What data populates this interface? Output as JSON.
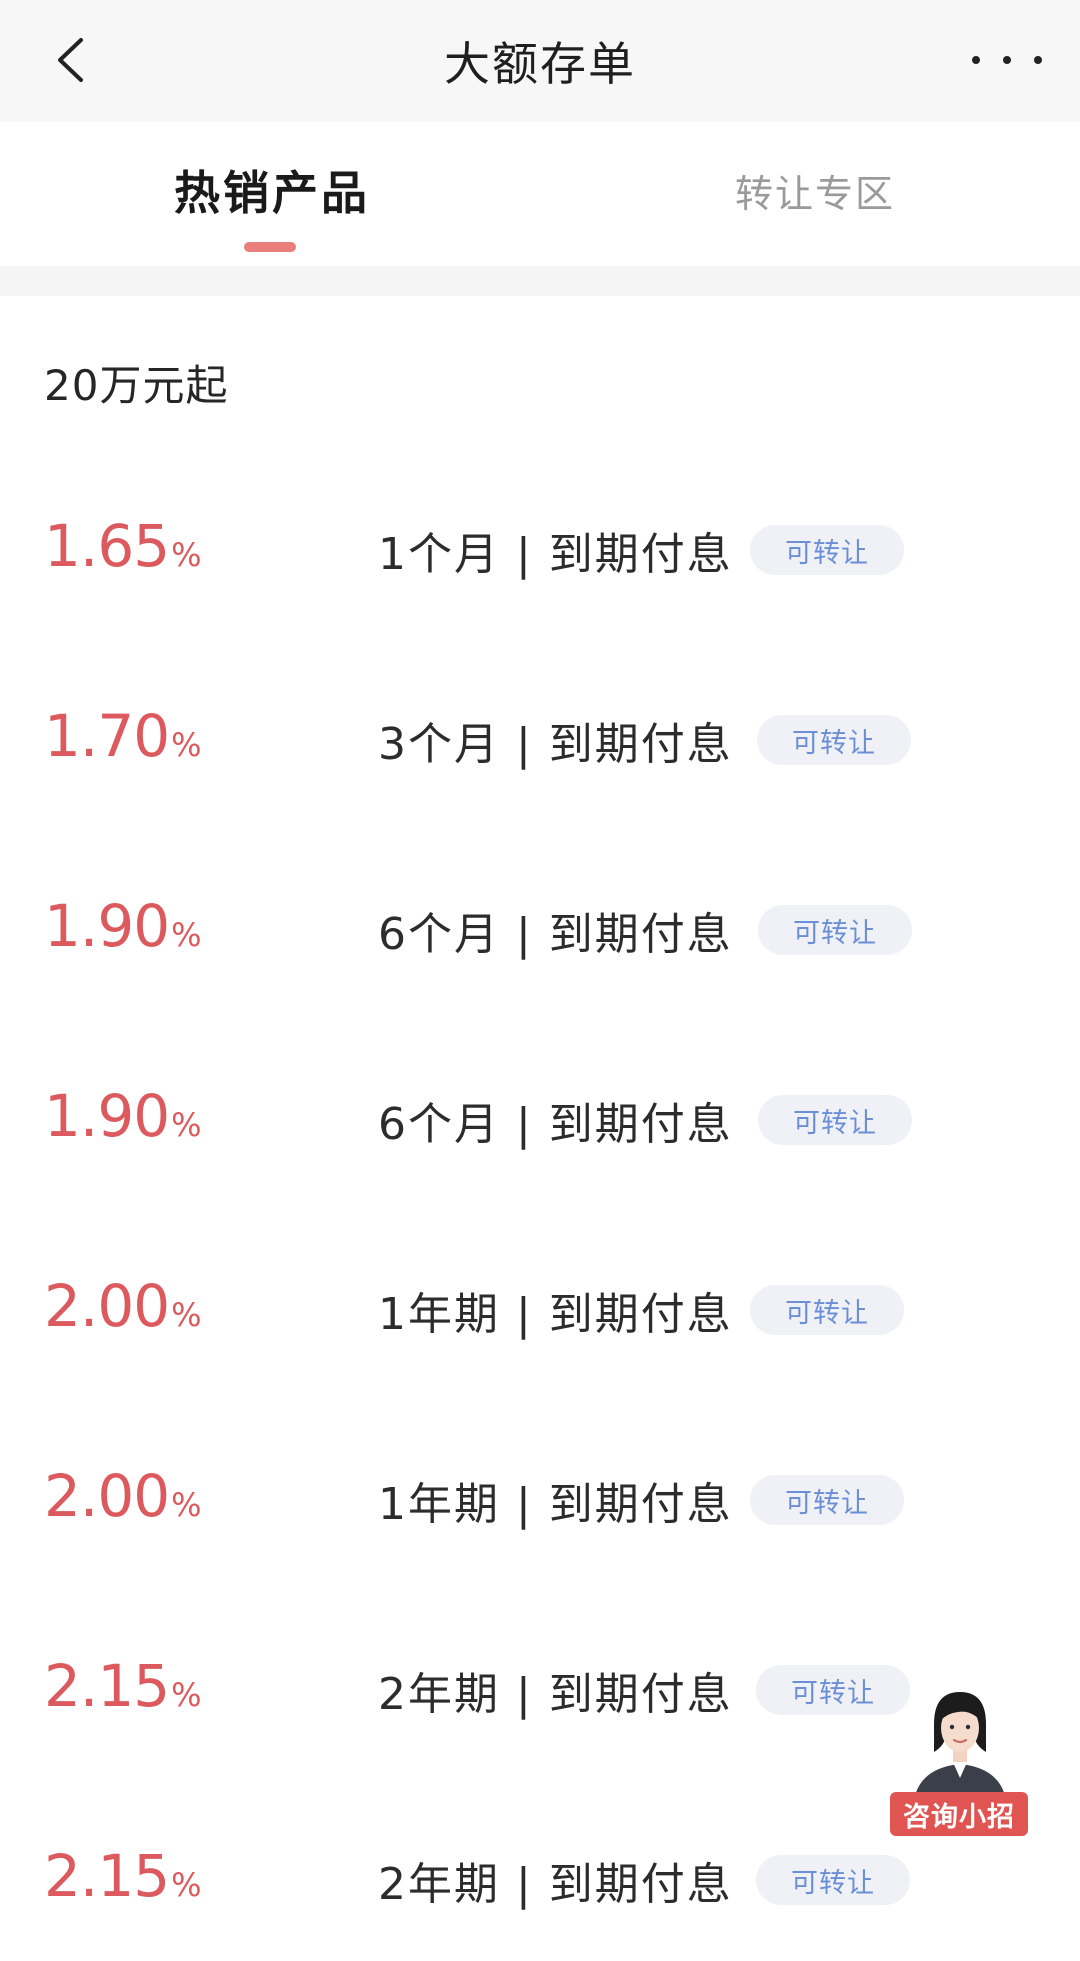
{
  "header": {
    "title": "大额存单"
  },
  "tabs": [
    {
      "label": "热销产品",
      "active": true
    },
    {
      "label": "转让专区",
      "active": false
    }
  ],
  "section": {
    "title": "20万元起"
  },
  "products": [
    {
      "rate": "1.65",
      "unit": "%",
      "term": "1个月 | 到期付息",
      "badge": "可转让"
    },
    {
      "rate": "1.70",
      "unit": "%",
      "term": "3个月 | 到期付息",
      "badge": "可转让"
    },
    {
      "rate": "1.90",
      "unit": "%",
      "term": "6个月 | 到期付息",
      "badge": "可转让"
    },
    {
      "rate": "1.90",
      "unit": "%",
      "term": "6个月 | 到期付息",
      "badge": "可转让"
    },
    {
      "rate": "2.00",
      "unit": "%",
      "term": "1年期 | 到期付息",
      "badge": "可转让"
    },
    {
      "rate": "2.00",
      "unit": "%",
      "term": "1年期 | 到期付息",
      "badge": "可转让"
    },
    {
      "rate": "2.15",
      "unit": "%",
      "term": "2年期 | 到期付息",
      "badge": "可转让"
    },
    {
      "rate": "2.15",
      "unit": "%",
      "term": "2年期 | 到期付息",
      "badge": "可转让"
    }
  ],
  "assistant": {
    "label": "咨询小招"
  },
  "colors": {
    "rate": "#dc5a5e",
    "badge_text": "#6b8fd6",
    "tab_indicator": "#ea7e7c",
    "assistant_label": "#e05552"
  },
  "icons": {
    "back": "chevron-left-icon",
    "more": "more-dots-icon"
  }
}
